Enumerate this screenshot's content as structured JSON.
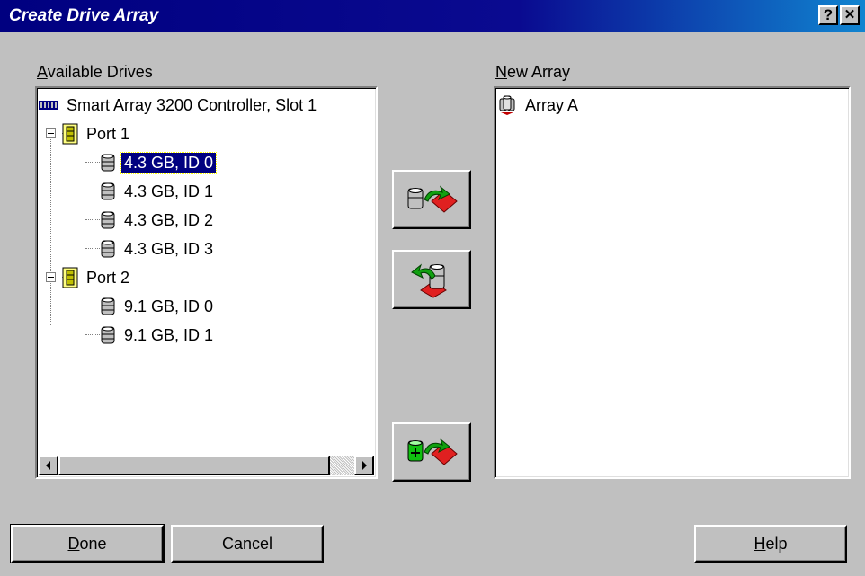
{
  "window": {
    "title": "Create Drive Array",
    "help_glyph": "?",
    "close_glyph": "✕"
  },
  "available": {
    "label_mnemonic": "A",
    "label_rest": "vailable Drives",
    "controller": "Smart Array 3200 Controller, Slot 1",
    "ports": [
      {
        "label": "Port 1",
        "drives": [
          "4.3 GB, ID 0",
          "4.3 GB, ID 1",
          "4.3 GB, ID 2",
          "4.3 GB, ID 3"
        ]
      },
      {
        "label": "Port 2",
        "drives": [
          "9.1 GB, ID 0",
          "9.1 GB, ID 1"
        ]
      }
    ],
    "selected": "4.3 GB, ID 0"
  },
  "new_array": {
    "label_mnemonic": "N",
    "label_rest": "ew Array",
    "items": [
      "Array A"
    ]
  },
  "actions": {
    "add_icon": "drive-to-array-icon",
    "remove_icon": "array-to-drive-icon",
    "spare_icon": "spare-drive-icon"
  },
  "footer": {
    "done_mnemonic": "D",
    "done_rest": "one",
    "cancel": "Cancel",
    "help_mnemonic": "H",
    "help_rest": "elp"
  },
  "colors": {
    "titlebar": "#000080",
    "selection": "#000080",
    "face": "#c0c0c0",
    "arrow_red": "#e02020",
    "arrow_green": "#10a010"
  }
}
